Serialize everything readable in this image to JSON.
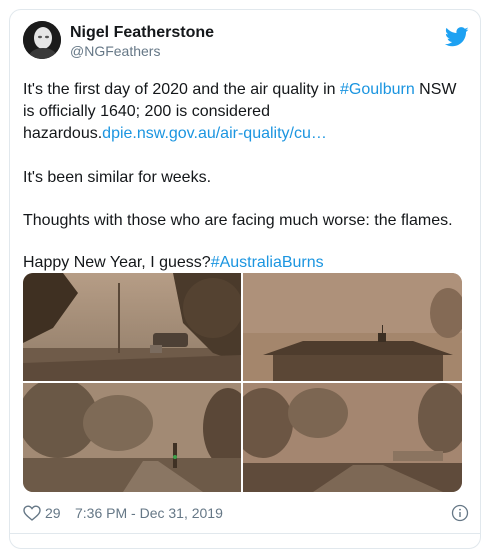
{
  "tweet": {
    "author": {
      "display_name": "Nigel Featherstone",
      "handle": "@NGFeathers",
      "avatar_icon": "profile-photo"
    },
    "brand_icon": "twitter-bird-icon",
    "brand_color": "#1da1f2",
    "link_color": "#1b95e0",
    "paragraph1": {
      "text_a": "It's the first day of 2020 and the air quality in ",
      "hashtag": "#Goulburn",
      "text_b": " NSW is officially 1640; 200 is considered hazardous.",
      "url": "dpie.nsw.gov.au/air-quality/cu…"
    },
    "paragraph2": "It's been similar for weeks.",
    "paragraph3": "Thoughts with those who are facing much worse: the flames.",
    "paragraph4": {
      "text": "Happy New Year, I guess?",
      "hashtag": "#AustraliaBurns"
    },
    "media": [
      {
        "name": "smoky-street-with-car-photo"
      },
      {
        "name": "smoky-rooftop-photo"
      },
      {
        "name": "smoky-road-with-trees-photo"
      },
      {
        "name": "smoky-intersection-photo"
      }
    ],
    "footer": {
      "like_count": "29",
      "timestamp": "7:36 PM - Dec 31, 2019",
      "like_icon": "heart-icon",
      "info_icon": "info-icon"
    }
  }
}
